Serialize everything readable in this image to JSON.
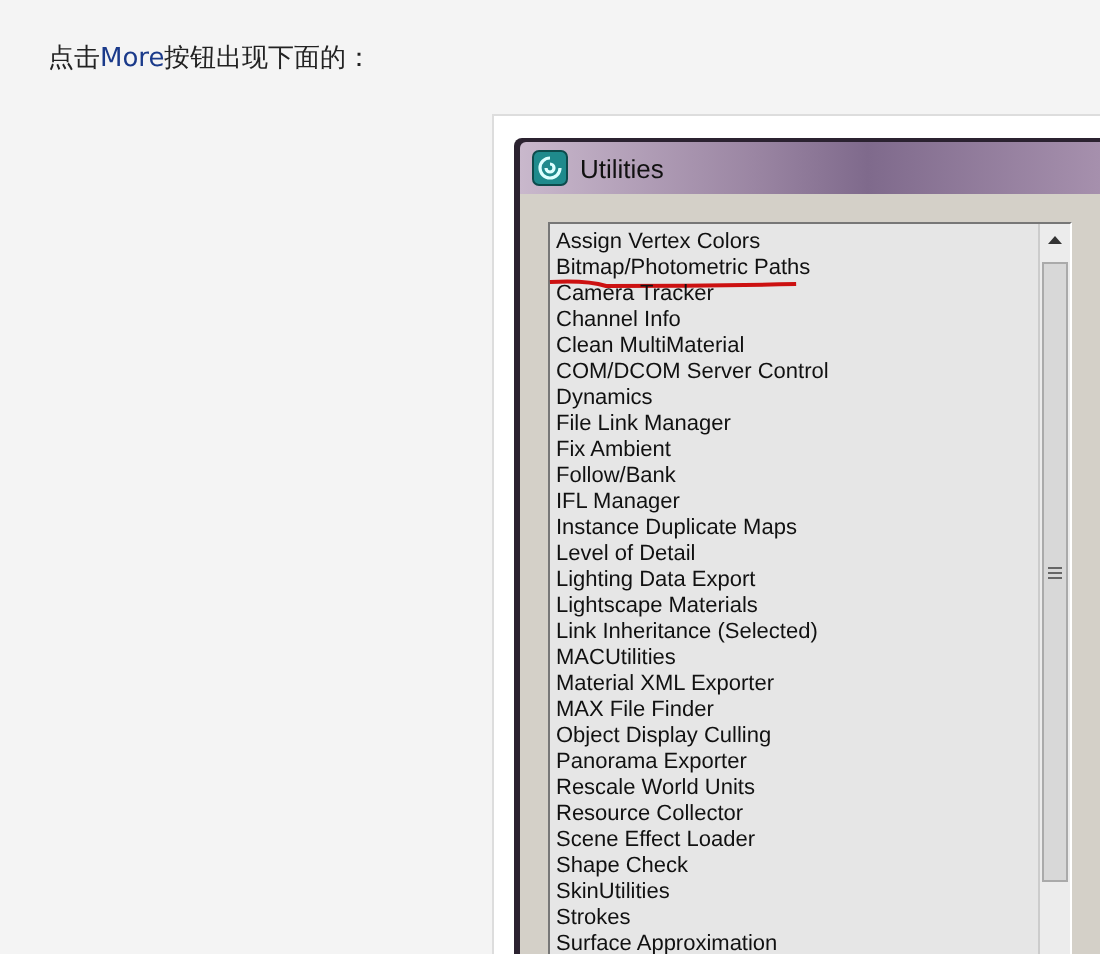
{
  "intro": {
    "before": "点击",
    "highlight": "More",
    "after": "按钮出现下面的："
  },
  "window": {
    "title": "Utilities"
  },
  "items": [
    {
      "label": "Assign Vertex Colors",
      "marked": false
    },
    {
      "label": "Bitmap/Photometric Paths",
      "marked": true
    },
    {
      "label": "Camera Tracker",
      "marked": false
    },
    {
      "label": "Channel Info",
      "marked": false
    },
    {
      "label": "Clean MultiMaterial",
      "marked": false
    },
    {
      "label": "COM/DCOM Server Control",
      "marked": false
    },
    {
      "label": "Dynamics",
      "marked": false
    },
    {
      "label": "File Link Manager",
      "marked": false
    },
    {
      "label": "Fix Ambient",
      "marked": false
    },
    {
      "label": "Follow/Bank",
      "marked": false
    },
    {
      "label": "IFL Manager",
      "marked": false
    },
    {
      "label": "Instance Duplicate Maps",
      "marked": false
    },
    {
      "label": "Level of Detail",
      "marked": false
    },
    {
      "label": "Lighting Data Export",
      "marked": false
    },
    {
      "label": "Lightscape Materials",
      "marked": false
    },
    {
      "label": "Link Inheritance (Selected)",
      "marked": false
    },
    {
      "label": "MACUtilities",
      "marked": false
    },
    {
      "label": "Material XML Exporter",
      "marked": false
    },
    {
      "label": "MAX File Finder",
      "marked": false
    },
    {
      "label": "Object Display Culling",
      "marked": false
    },
    {
      "label": "Panorama Exporter",
      "marked": false
    },
    {
      "label": "Rescale World Units",
      "marked": false
    },
    {
      "label": "Resource Collector",
      "marked": false
    },
    {
      "label": "Scene Effect Loader",
      "marked": false
    },
    {
      "label": "Shape Check",
      "marked": false
    },
    {
      "label": "SkinUtilities",
      "marked": false
    },
    {
      "label": "Strokes",
      "marked": false
    },
    {
      "label": "Surface Approximation",
      "marked": false
    }
  ]
}
